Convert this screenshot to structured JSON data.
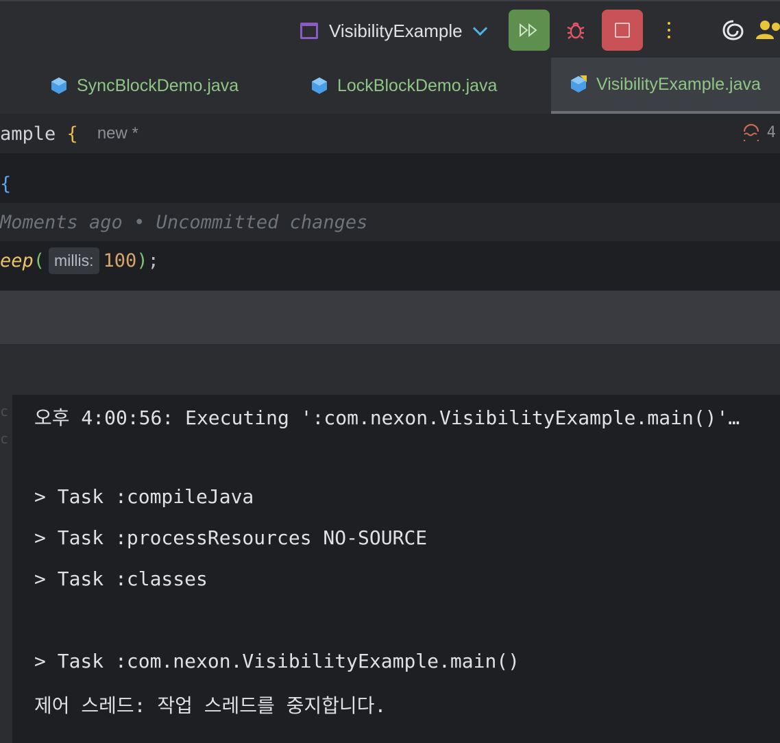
{
  "toolbar": {
    "run_config_label": "VisibilityExample",
    "icons": [
      "run-config-icon",
      "chevron-down-icon",
      "rerun-icon",
      "debug-icon",
      "stop-icon",
      "more-icon",
      "ai-assistant-icon",
      "user-icon"
    ]
  },
  "tabs": [
    {
      "label": "SyncBlockDemo.java",
      "active": false
    },
    {
      "label": "LockBlockDemo.java",
      "active": false
    },
    {
      "label": "VisibilityExample.java",
      "active": true
    }
  ],
  "editor": {
    "sticky_class": "ample",
    "sticky_brace": "{",
    "sticky_hint": "new *",
    "warning_count": "4",
    "line_brace": "{",
    "blame_text": "Moments ago • Uncommitted changes",
    "sleep_fn": "eep",
    "sleep_open": "(",
    "inlay_hint": "millis:",
    "sleep_arg": "100",
    "sleep_close": ")",
    "sleep_semicolon": ";"
  },
  "console": {
    "lines": [
      "오후 4:00:56: Executing ':com.nexon.VisibilityExample.main()'…",
      "",
      "> Task :compileJava",
      "> Task :processResources NO-SOURCE",
      "> Task :classes",
      "",
      "> Task :com.nexon.VisibilityExample.main()",
      "제어 스레드: 작업 스레드를 중지합니다."
    ],
    "gutter": [
      "c",
      "c"
    ]
  },
  "colors": {
    "run_button": "#5f8f4f",
    "stop_button": "#c95257",
    "tab_text": "#8fc586",
    "console_bg": "#1e1f22"
  }
}
